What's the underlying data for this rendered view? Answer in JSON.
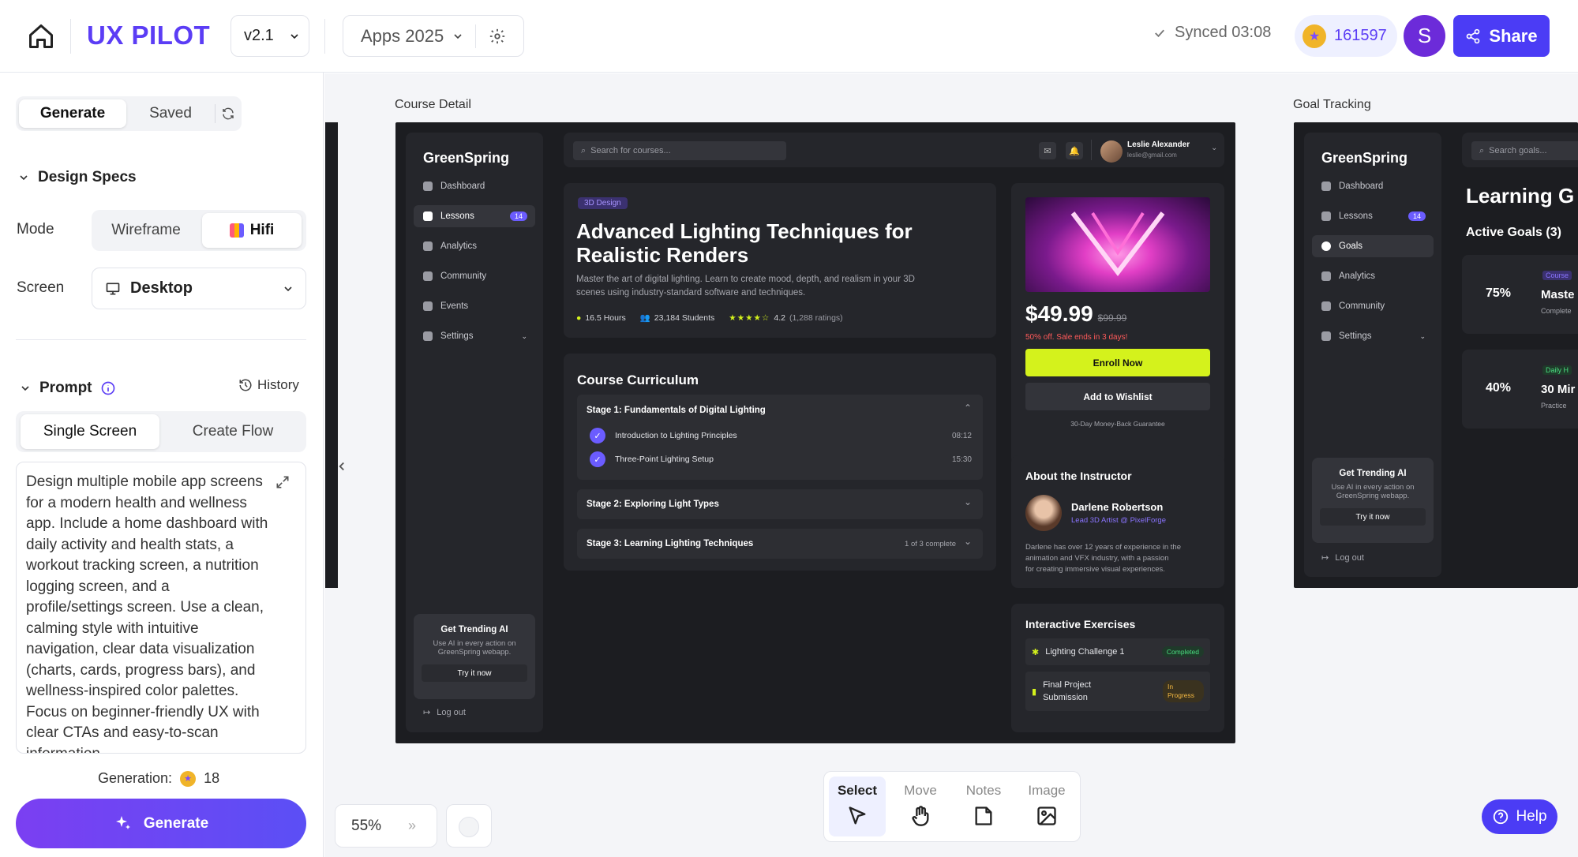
{
  "topbar": {
    "brand": "UX PILOT",
    "version": "v2.1",
    "project": "Apps 2025",
    "sync_status": "Synced 03:08",
    "credits": "161597",
    "avatar_initial": "S",
    "share_label": "Share"
  },
  "left": {
    "tabs": {
      "generate": "Generate",
      "saved": "Saved"
    },
    "design_specs": "Design Specs",
    "mode_label": "Mode",
    "mode_options": {
      "wireframe": "Wireframe",
      "hifi": "Hifi"
    },
    "screen_label": "Screen",
    "screen_value": "Desktop",
    "prompt_title": "Prompt",
    "history": "History",
    "prompt_tabs": {
      "single": "Single Screen",
      "flow": "Create Flow"
    },
    "prompt_text": "Design multiple mobile app screens for a modern health and wellness app. Include a home dashboard with daily activity and health stats, a workout tracking screen, a nutrition logging screen, and a profile/settings screen. Use a clean, calming style with intuitive navigation, clear data visualization (charts, cards, progress bars), and wellness-inspired color palettes. Focus on beginner-friendly UX with clear CTAs and easy-to-scan information.",
    "generation_label": "Generation:",
    "generation_count": "18",
    "generate_button": "Generate"
  },
  "canvas": {
    "zoom": "55%",
    "artboard1_label": "Course Detail",
    "artboard2_label": "Goal Tracking",
    "tools": {
      "select": "Select",
      "move": "Move",
      "notes": "Notes",
      "image": "Image"
    },
    "help": "Help"
  },
  "course": {
    "brand": "GreenSpring",
    "nav": [
      "Dashboard",
      "Lessons",
      "Analytics",
      "Community",
      "Events",
      "Settings"
    ],
    "lessons_badge": "14",
    "search_placeholder": "Search for courses...",
    "user_name": "Leslie Alexander",
    "user_email": "leslie@gmail.com",
    "tag": "3D Design",
    "title_line1": "Advanced Lighting Techniques for",
    "title_line2": "Realistic Renders",
    "desc_line1": "Master the art of digital lighting. Learn to create mood, depth, and realism in your 3D",
    "desc_line2": "scenes using industry-standard software and techniques.",
    "hours": "16.5 Hours",
    "students": "23,184 Students",
    "rating": "4.2",
    "ratings_count": "(1,288 ratings)",
    "rating_stars": 4,
    "price": "$49.99",
    "old_price": "$99.99",
    "sale": "50% off. Sale ends in 3 days!",
    "enroll": "Enroll Now",
    "wishlist": "Add to Wishlist",
    "guarantee": "30-Day Money-Back Guarantee",
    "curriculum_title": "Course Curriculum",
    "stage1": "Stage 1: Fundamentals of Digital Lighting",
    "lesson1": "Introduction to Lighting Principles",
    "lesson1_time": "08:12",
    "lesson2": "Three-Point Lighting Setup",
    "lesson2_time": "15:30",
    "stage2": "Stage 2: Exploring Light Types",
    "stage3": "Stage 3: Learning Lighting Techniques",
    "stage3_progress": "1 of 3 complete",
    "instructor_title": "About the Instructor",
    "instructor_name": "Darlene Robertson",
    "instructor_role": "Lead 3D Artist @ PixelForge",
    "instructor_bio_line1": "Darlene has over 12 years of experience in the",
    "instructor_bio_line2": "animation and VFX industry, with a passion",
    "instructor_bio_line3": "for creating immersive visual experiences.",
    "exercises_title": "Interactive Exercises",
    "exercise1": "Lighting Challenge 1",
    "exercise1_status": "Completed",
    "exercise2_line1": "Final Project",
    "exercise2_line2": "Submission",
    "exercise2_status_line1": "In",
    "exercise2_status_line2": "Progress",
    "trending_title": "Get Trending AI",
    "trending_line1": "Use AI in every action on",
    "trending_line2": "GreenSpring webapp.",
    "trending_btn": "Try it now",
    "logout": "Log out"
  },
  "goals": {
    "brand": "GreenSpring",
    "nav": [
      "Dashboard",
      "Lessons",
      "Goals",
      "Analytics",
      "Community",
      "Settings"
    ],
    "lessons_badge": "14",
    "search_placeholder": "Search goals...",
    "heading": "Learning G",
    "active": "Active Goals (3)",
    "goal1_pct": "75%",
    "goal1_tag": "Course",
    "goal1_title": "Maste",
    "goal1_sub": "Complete",
    "goal2_pct": "40%",
    "goal2_tag": "Daily H",
    "goal2_title": "30 Mir",
    "goal2_sub": "Practice",
    "trending_title": "Get Trending AI",
    "trending_line1": "Use AI in every action on",
    "trending_line2": "GreenSpring webapp.",
    "trending_btn": "Try it now",
    "logout": "Log out"
  },
  "colors": {
    "brand": "#5b3df5",
    "lime": "#d4f21c",
    "dark_bg": "#1c1d21",
    "card_bg": "#25262b"
  }
}
